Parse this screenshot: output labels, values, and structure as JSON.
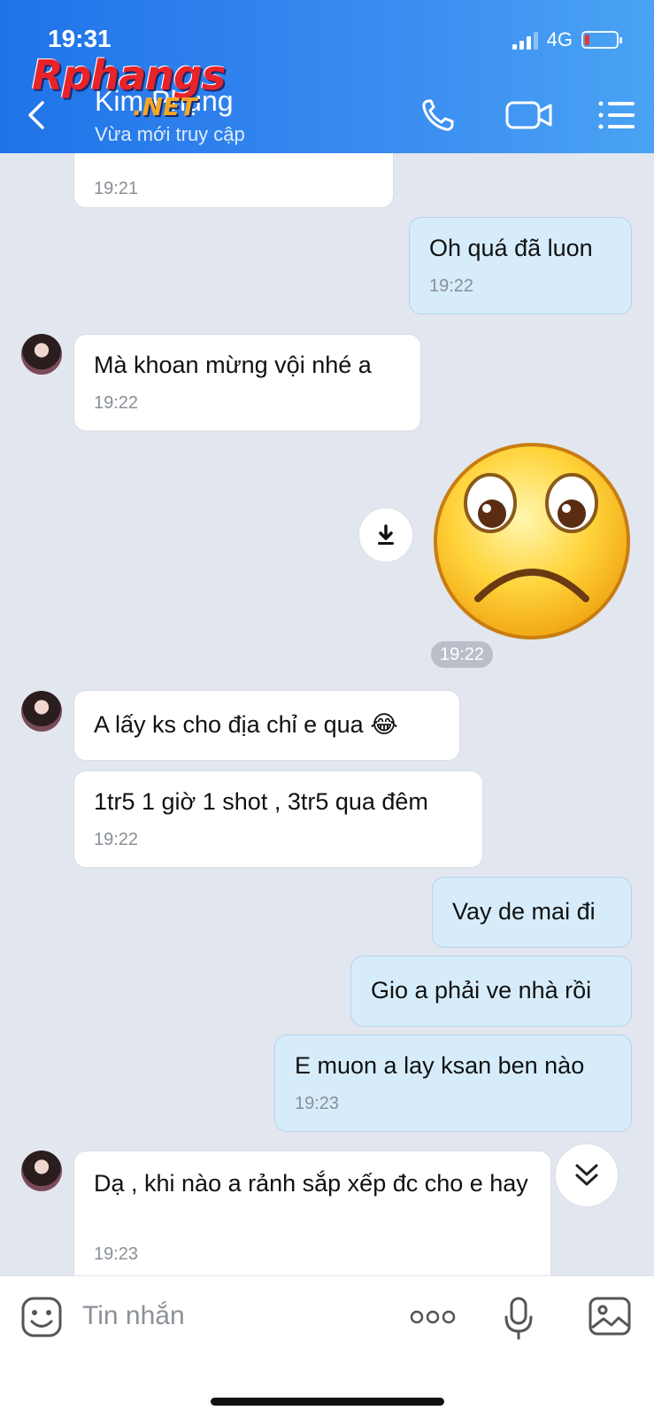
{
  "status_bar": {
    "time": "19:31",
    "network": "4G"
  },
  "header": {
    "contact_name": "Kim Phụng",
    "contact_status": "Vừa mới truy cập",
    "accent": "#2f80ed"
  },
  "watermark": {
    "brand": "Rphangs",
    "suffix": ".NET"
  },
  "messages": [
    {
      "direction": "in",
      "text": "",
      "time": "19:21"
    },
    {
      "direction": "out",
      "text": "Oh quá đã luon",
      "time": "19:22"
    },
    {
      "direction": "in",
      "text": "Mà khoan mừng vội nhé a",
      "time": "19:22"
    },
    {
      "direction": "out",
      "type": "sticker",
      "sticker": "sad-face-sticker",
      "time": "19:22"
    },
    {
      "direction": "in",
      "text": "A lấy ks cho địa chỉ e qua 😂",
      "time": ""
    },
    {
      "direction": "in",
      "text": "1tr5 1 giờ 1 shot , 3tr5 qua đêm",
      "time": "19:22"
    },
    {
      "direction": "out",
      "text": "Vay de mai đi",
      "time": ""
    },
    {
      "direction": "out",
      "text": "Gio a phải ve nhà rồi",
      "time": ""
    },
    {
      "direction": "out",
      "text": "E muon a lay ksan ben nào",
      "time": "19:23"
    },
    {
      "direction": "in",
      "text": "Dạ , khi nào a rảnh sắp xếp đc cho e hay",
      "time": "19:23"
    }
  ],
  "composer": {
    "placeholder": "Tin nhắn"
  },
  "icons": [
    "back-icon",
    "phone-icon",
    "video-call-icon",
    "menu-icon",
    "download-icon",
    "scroll-down-icon",
    "emoji-icon",
    "more-icon",
    "mic-icon",
    "image-icon"
  ]
}
